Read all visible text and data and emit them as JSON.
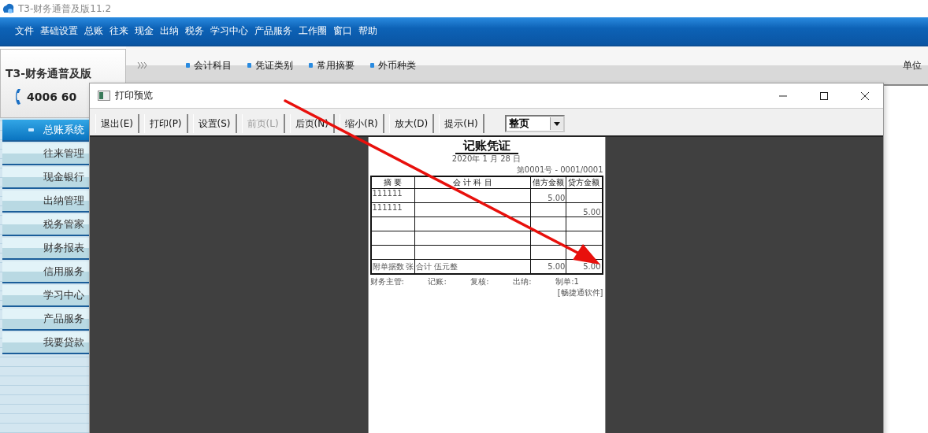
{
  "window": {
    "title": "T3-财务通普及版11.2"
  },
  "menu": [
    "文件",
    "基础设置",
    "总账",
    "往来",
    "现金",
    "出纳",
    "税务",
    "学习中心",
    "产品服务",
    "工作圈",
    "窗口",
    "帮助"
  ],
  "logo": {
    "text": "T3-财务通普及版",
    "phone": "4006 60"
  },
  "nav": {
    "items": [
      "会计科目",
      "凭证类别",
      "常用摘要",
      "外币种类"
    ],
    "right_label": "单位"
  },
  "sidebar": [
    {
      "label": "总账系统",
      "selected": true
    },
    {
      "label": "往来管理",
      "selected": false
    },
    {
      "label": "现金银行",
      "selected": false
    },
    {
      "label": "出纳管理",
      "selected": false
    },
    {
      "label": "税务管家",
      "selected": false
    },
    {
      "label": "财务报表",
      "selected": false
    },
    {
      "label": "信用服务",
      "selected": false
    },
    {
      "label": "学习中心",
      "selected": false
    },
    {
      "label": "产品服务",
      "selected": false
    },
    {
      "label": "我要贷款",
      "selected": false
    }
  ],
  "dialog": {
    "title": "打印预览",
    "toolbar": [
      {
        "label": "退出(E)",
        "disabled": false
      },
      {
        "label": "打印(P)",
        "disabled": false
      },
      {
        "label": "设置(S)",
        "disabled": false
      },
      {
        "label": "前页(L)",
        "disabled": true
      },
      {
        "label": "后页(N)",
        "disabled": false
      },
      {
        "label": "缩小(R)",
        "disabled": false
      },
      {
        "label": "放大(D)",
        "disabled": false
      },
      {
        "label": "提示(H)",
        "disabled": false
      }
    ],
    "zoom_select": "整页"
  },
  "voucher": {
    "title": "记账凭证",
    "date": "2020年 1 月 28 日",
    "number": "第0001号 - 0001/0001",
    "headers": [
      "摘 要",
      "会 计 科 目",
      "借方金额",
      "贷方金额"
    ],
    "rows": [
      {
        "summary": "111111",
        "debit": "5.00",
        "credit": ""
      },
      {
        "summary": "111111",
        "debit": "",
        "credit": "5.00"
      },
      {
        "summary": "",
        "debit": "",
        "credit": ""
      },
      {
        "summary": "",
        "debit": "",
        "credit": ""
      },
      {
        "summary": "",
        "debit": "",
        "credit": ""
      }
    ],
    "attachments_label": "附单据数",
    "attachments_unit": "张",
    "total_label": "合计 伍元整",
    "total_debit": "5.00",
    "total_credit": "5.00",
    "signatures": [
      "财务主管:",
      "记账:",
      "复核:",
      "出纳:",
      "制单:1"
    ],
    "stamp": "[畅捷通软件]"
  }
}
